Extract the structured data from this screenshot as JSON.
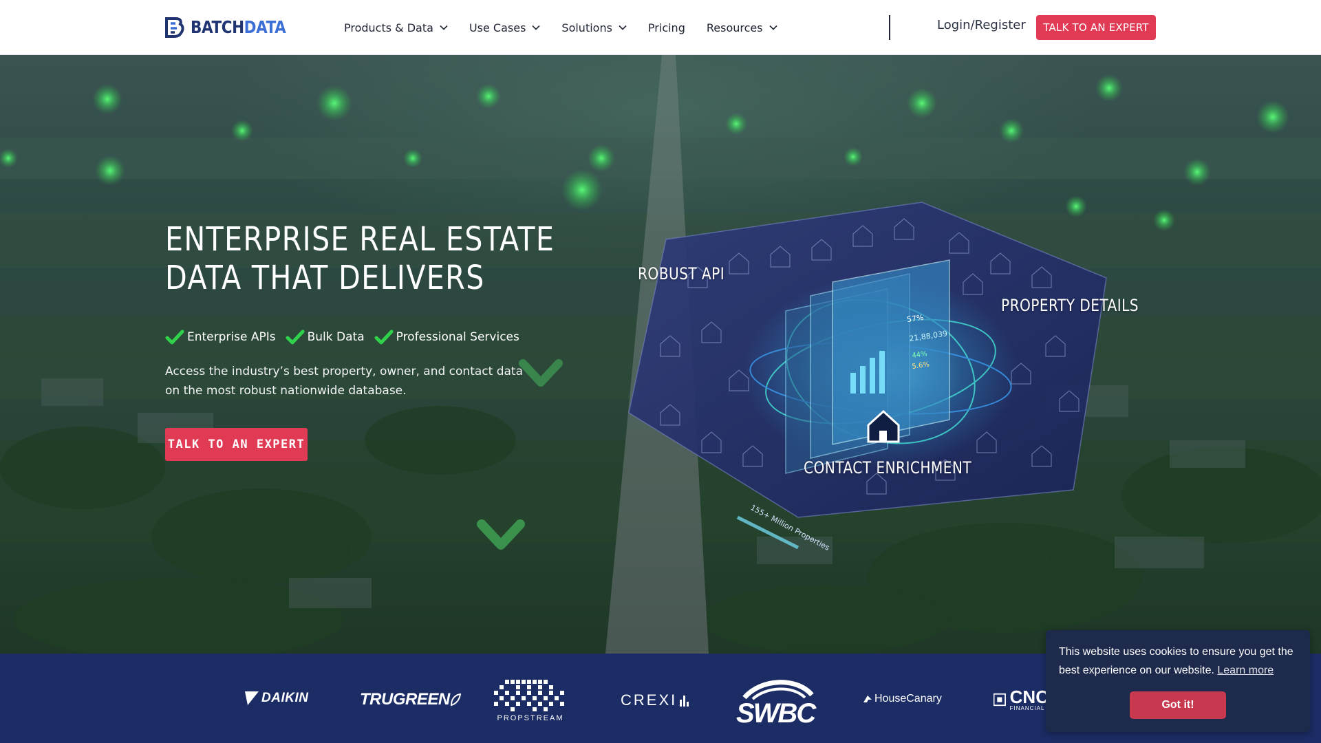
{
  "brand": {
    "name_part1": "BATCH",
    "name_part2": "DATA",
    "colors": {
      "navy": "#1f3470",
      "blue": "#3b6fd6",
      "accent": "#e03a55",
      "strip": "#1c2d66"
    }
  },
  "nav": {
    "items": [
      {
        "label": "Products & Data",
        "has_dropdown": true
      },
      {
        "label": "Use Cases",
        "has_dropdown": true
      },
      {
        "label": "Solutions",
        "has_dropdown": true
      },
      {
        "label": "Pricing",
        "has_dropdown": false
      },
      {
        "label": "Resources",
        "has_dropdown": true
      }
    ],
    "login_label": "Login/Register",
    "cta_label": "TALK TO AN EXPERT"
  },
  "hero": {
    "title_line1": "ENTERPRISE REAL ESTATE",
    "title_line2": "DATA THAT DELIVERS",
    "checks": [
      "Enterprise APIs",
      "Bulk Data",
      "Professional Services"
    ],
    "description": "Access the industry’s best property, owner, and contact data on the most robust nationwide database.",
    "cta_label": "TALK TO AN EXPERT",
    "features": {
      "robust_api": "ROBUST API",
      "property_details": "PROPERTY DETAILS",
      "contact_enrichment": "CONTACT ENRICHMENT"
    },
    "illustration": {
      "properties_caption": "155+ Million Properties",
      "stats": [
        "57%",
        "21,88,039",
        "44%",
        "5.6%"
      ]
    }
  },
  "logos": {
    "daikin": "DAIKIN",
    "trugreen": "TRUGREEN",
    "propstream": "PROPSTREAM",
    "crexi": "CREXI",
    "swbc": "SWBC",
    "housecanary": "HouseCanary",
    "cnc": "CNC",
    "cnc_sub": "FINANCIAL"
  },
  "cookie": {
    "message": "This website uses cookies to ensure you get the best experience on our website.",
    "learn_more": "Learn more",
    "accept_label": "Got it!"
  }
}
